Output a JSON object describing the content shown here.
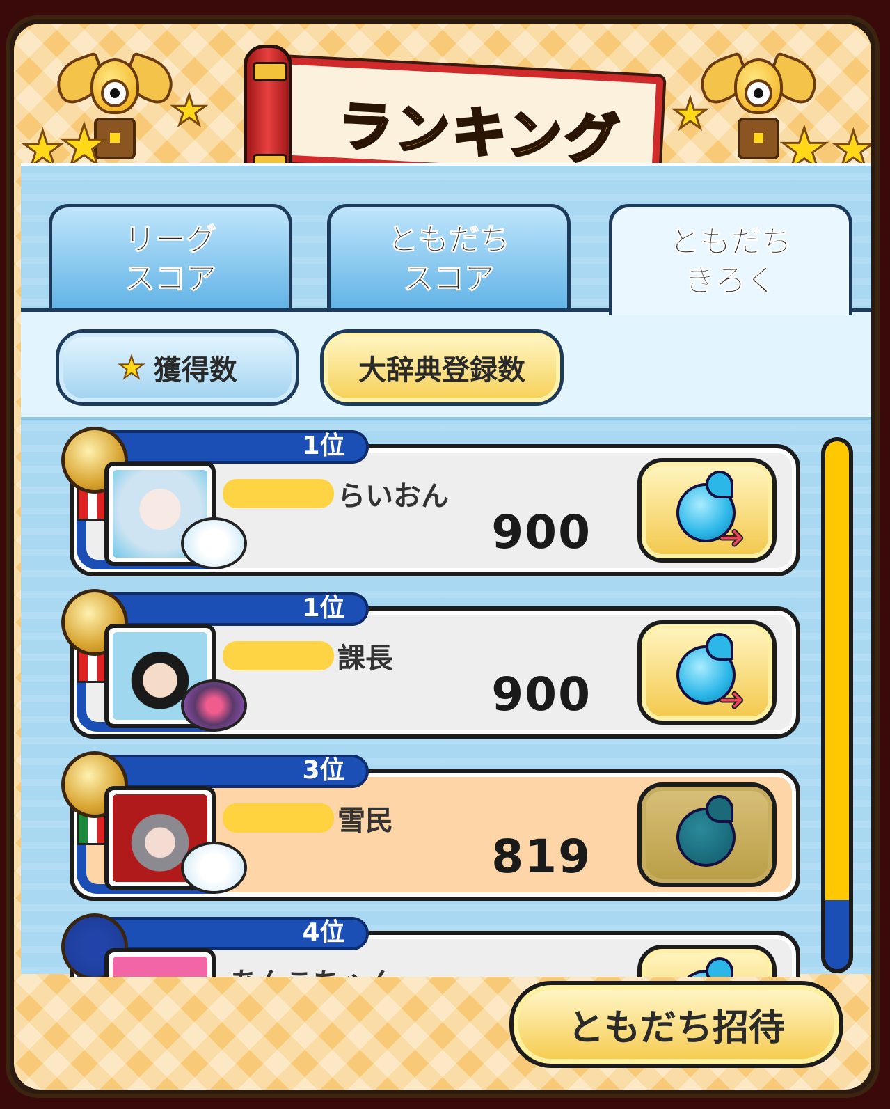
{
  "header": {
    "title": "ランキング"
  },
  "tabs": [
    {
      "line1": "リーグ",
      "line2": "スコア",
      "active": false
    },
    {
      "line1": "ともだち",
      "line2": "スコア",
      "active": false
    },
    {
      "line1": "ともだち",
      "line2": "きろく",
      "active": true
    }
  ],
  "filters": {
    "obtained_label": "獲得数",
    "encyclopedia_label": "大辞典登録数",
    "selected": "大辞典登録数"
  },
  "ranking": [
    {
      "rank": "1位",
      "name": "らいおん",
      "score": "900",
      "medal": "gold",
      "self": false,
      "gift_enabled": true
    },
    {
      "rank": "1位",
      "name": "課長",
      "score": "900",
      "medal": "gold",
      "self": false,
      "gift_enabled": true
    },
    {
      "rank": "3位",
      "name": "雪民",
      "score": "819",
      "medal": "gold",
      "self": true,
      "gift_enabled": false
    },
    {
      "rank": "4位",
      "name": "あんこちゃん",
      "score": "",
      "medal": "swirl",
      "self": false,
      "gift_enabled": true
    }
  ],
  "scroll": {
    "position_fraction": 0.87
  },
  "footer": {
    "invite_label": "ともだち招待"
  },
  "icons": {
    "trophy": "winged-trophy-icon",
    "star": "star-icon",
    "gift": "soul-gourd-send-icon"
  },
  "colors": {
    "accent_blue": "#1c4fb5",
    "gold": "#ffd81a",
    "self_row": "#fdd5a6"
  }
}
